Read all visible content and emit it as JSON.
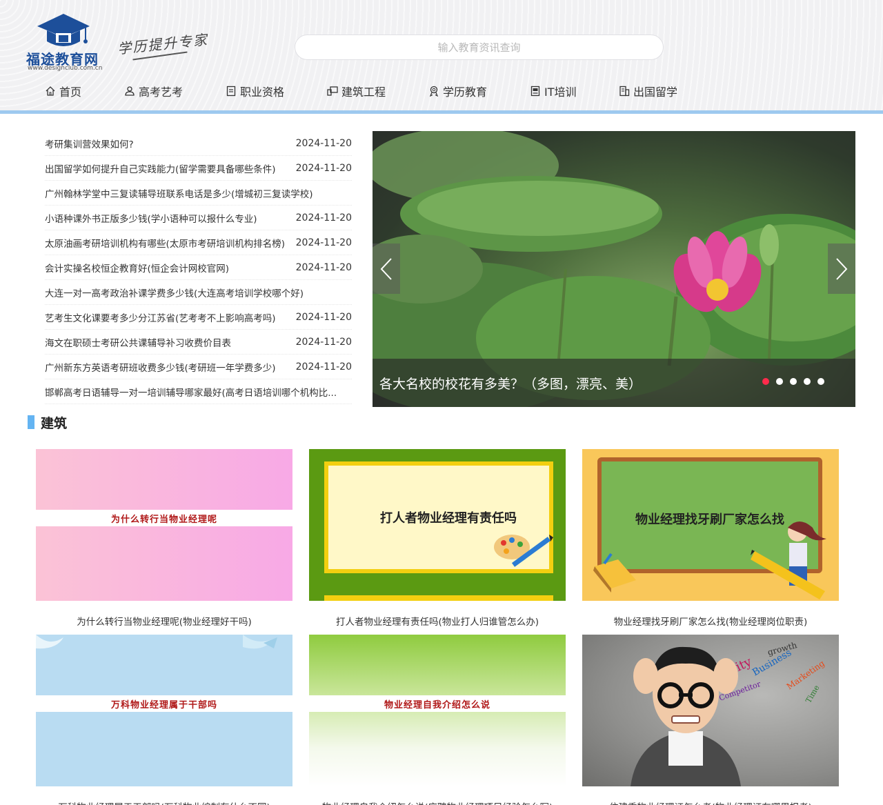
{
  "site": {
    "logo_text": "福途教育网",
    "logo_url_text": "www.designclub.com.cn",
    "slogan": "学历提升专家"
  },
  "search": {
    "placeholder": "输入教育资讯查询",
    "value": ""
  },
  "nav": [
    {
      "label": "首页",
      "icon": "home-icon"
    },
    {
      "label": "高考艺考",
      "icon": "user-icon"
    },
    {
      "label": "职业资格",
      "icon": "document-icon"
    },
    {
      "label": "建筑工程",
      "icon": "monitor-icon"
    },
    {
      "label": "学历教育",
      "icon": "badge-icon"
    },
    {
      "label": "IT培训",
      "icon": "notebook-icon"
    },
    {
      "label": "出国留学",
      "icon": "building-icon"
    }
  ],
  "news": [
    {
      "title": "考研集训营效果如何?",
      "date": "2024-11-20"
    },
    {
      "title": "出国留学如何提升自己实践能力(留学需要具备哪些条件)",
      "date": "2024-11-20"
    },
    {
      "title": "广州翰林学堂中三复读辅导班联系电话是多少(增城初三复读学校)",
      "date": ""
    },
    {
      "title": "小语种课外书正版多少钱(学小语种可以报什么专业)",
      "date": "2024-11-20"
    },
    {
      "title": "太原油画考研培训机构有哪些(太原市考研培训机构排名榜)",
      "date": "2024-11-20"
    },
    {
      "title": "会计实操名校恒企教育好(恒企会计网校官网)",
      "date": "2024-11-20"
    },
    {
      "title": "大连一对一高考政治补课学费多少钱(大连高考培训学校哪个好)",
      "date": ""
    },
    {
      "title": "艺考生文化课要考多少分江苏省(艺考考不上影响高考吗)",
      "date": "2024-11-20"
    },
    {
      "title": "海文在职硕士考研公共课辅导补习收费价目表",
      "date": "2024-11-20"
    },
    {
      "title": "广州新东方英语考研班收费多少钱(考研班一年学费多少)",
      "date": "2024-11-20"
    },
    {
      "title": "邯郸高考日语辅导一对一培训辅导哪家最好(高考日语培训哪个机构比...",
      "date": ""
    }
  ],
  "carousel": {
    "caption": "各大名校的校花有多美？（多图，漂亮、美）",
    "slide_count": 5,
    "active_index": 0
  },
  "section": {
    "title": "建筑",
    "cards": [
      {
        "image_text": "为什么转行当物业经理呢",
        "caption": "为什么转行当物业经理呢(物业经理好干吗)"
      },
      {
        "image_text": "打人者物业经理有责任吗",
        "caption": "打人者物业经理有责任吗(物业打人归谁管怎么办)"
      },
      {
        "image_text": "物业经理找牙刷厂家怎么找",
        "caption": "物业经理找牙刷厂家怎么找(物业经理岗位职责)"
      },
      {
        "image_text": "万科物业经理属于干部吗",
        "caption": "万科物业经理属于干部吗(万科物业编制有什么不同)"
      },
      {
        "image_text": "物业经理自我介绍怎么说",
        "caption": "物业经理自我介绍怎么说(应聘物业经理项目经验怎么写)"
      },
      {
        "image_text": "",
        "caption": "住建委物业经理证怎么考(物业经理证在哪里报考)"
      }
    ]
  },
  "colors": {
    "accent": "#64b4f2",
    "nav_border": "#9ec9ef",
    "dot_active": "#ff2b4b",
    "logo_blue": "#1d4f9a"
  }
}
